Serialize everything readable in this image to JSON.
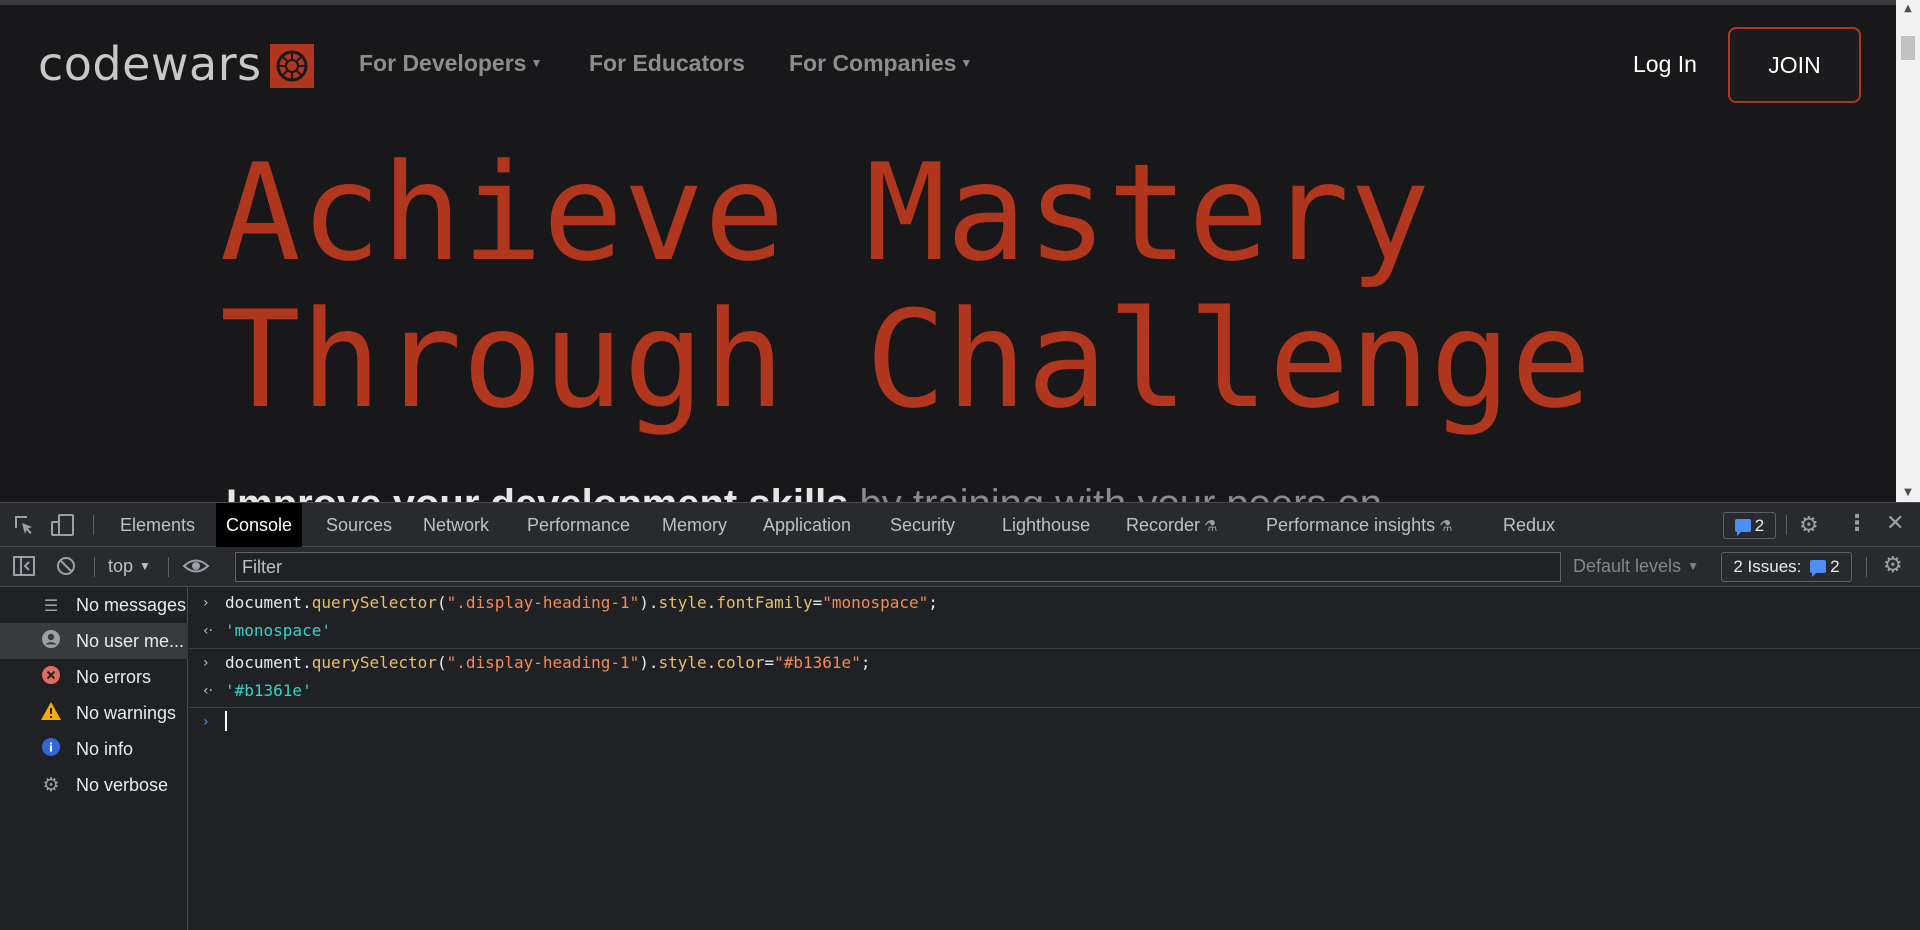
{
  "site": {
    "logo_text": "codewars",
    "nav": [
      {
        "label": "For Developers",
        "dropdown": true
      },
      {
        "label": "For Educators",
        "dropdown": false
      },
      {
        "label": "For Companies",
        "dropdown": true
      }
    ],
    "login_label": "Log In",
    "join_label": "JOIN",
    "hero_line1": "Achieve Mastery",
    "hero_line2": "Through Challenge",
    "hero_sub_bold": "Improve your development skills",
    "hero_sub_dim": "by training with your peers on"
  },
  "devtools": {
    "tabs": [
      "Elements",
      "Console",
      "Sources",
      "Network",
      "Performance",
      "Memory",
      "Application",
      "Security",
      "Lighthouse",
      "Recorder",
      "Performance insights",
      "Redux"
    ],
    "active_tab": "Console",
    "issues_count": "2",
    "toolbar": {
      "context": "top",
      "filter_placeholder": "Filter",
      "levels": "Default levels",
      "issues_label": "2 Issues:",
      "issues_count": "2"
    },
    "sidebar": [
      {
        "icon": "list-icon",
        "label": "No messages"
      },
      {
        "icon": "user-icon",
        "label": "No user me..."
      },
      {
        "icon": "error-icon",
        "label": "No errors"
      },
      {
        "icon": "warning-icon",
        "label": "No warnings"
      },
      {
        "icon": "info-icon",
        "label": "No info"
      },
      {
        "icon": "verbose-icon",
        "label": "No verbose"
      }
    ],
    "console": {
      "entries": [
        {
          "cmd_obj": "document.",
          "cmd_fn": "querySelector",
          "cmd_open": "(",
          "cmd_arg": "\".display-heading-1\"",
          "cmd_mid": ").",
          "cmd_prop": "style",
          "cmd_dot": ".",
          "cmd_prop2": "fontFamily",
          "cmd_eq": "=",
          "cmd_val": "\"monospace\"",
          "cmd_end": ";",
          "result": "'monospace'"
        },
        {
          "cmd_obj": "document.",
          "cmd_fn": "querySelector",
          "cmd_open": "(",
          "cmd_arg": "\".display-heading-1\"",
          "cmd_mid": ").",
          "cmd_prop": "style",
          "cmd_dot": ".",
          "cmd_prop2": "color",
          "cmd_eq": "=",
          "cmd_val": "\"#b1361e\"",
          "cmd_end": ";",
          "result": "'#b1361e'"
        }
      ]
    }
  },
  "colors": {
    "brand": "#b1361e",
    "page_bg": "#181719",
    "devtools_bg": "#202124",
    "console_string": "#f28b54",
    "console_result": "#35d4c7"
  }
}
